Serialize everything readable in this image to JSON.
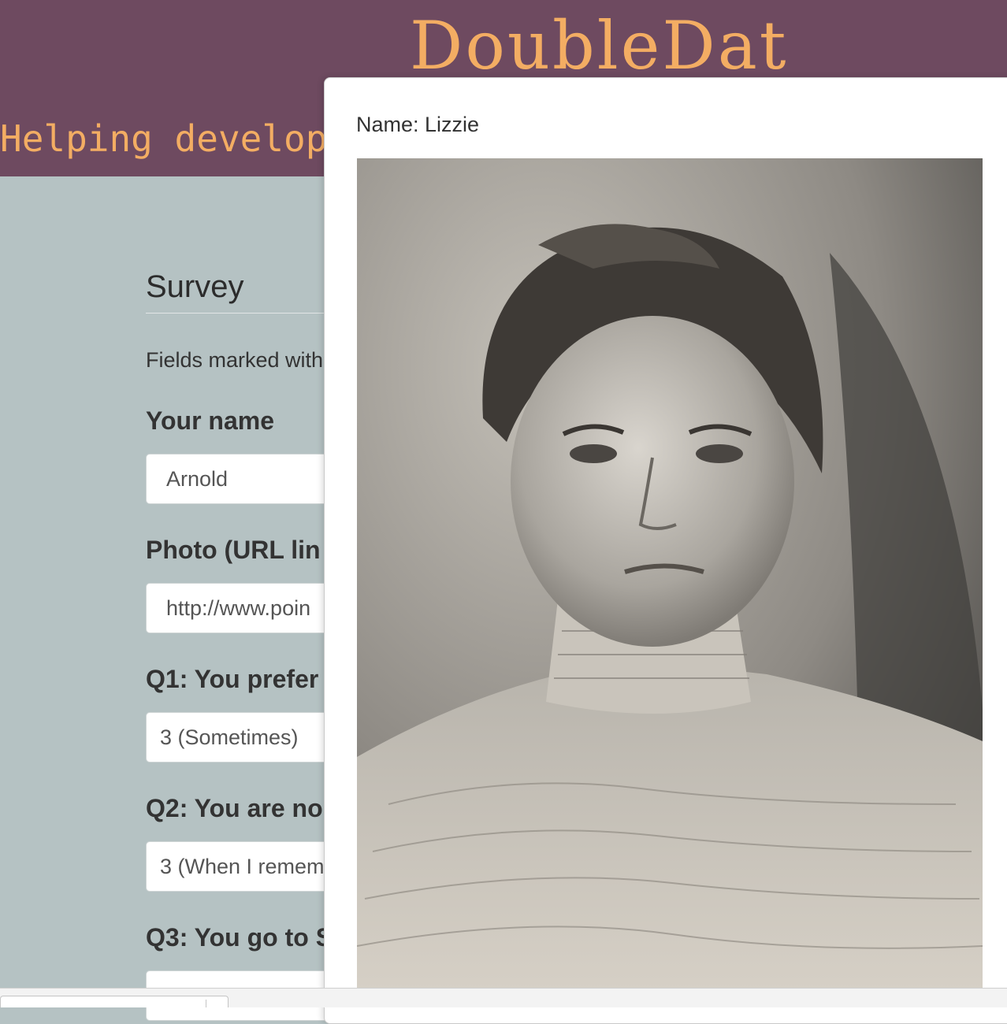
{
  "header": {
    "brand": "DoubleDat",
    "tagline": "Helping develop"
  },
  "survey": {
    "title": "Survey",
    "hint": "Fields marked with",
    "fields": [
      {
        "label": "Your name",
        "value": "Arnold"
      },
      {
        "label": "Photo (URL lin",
        "value": "http://www.poin"
      },
      {
        "label": "Q1: You prefer",
        "value": "3 (Sometimes)"
      },
      {
        "label": "Q2: You are no",
        "value": "3 (When I remem"
      },
      {
        "label": "Q3: You go to S",
        "value": ""
      }
    ]
  },
  "modal": {
    "name_text": "Name: Lizzie",
    "photo_icon": "portrait-photo"
  },
  "colors": {
    "header_bg": "#6e4a60",
    "brand_orange": "#f3ad63",
    "page_bg": "#b5c2c3"
  }
}
